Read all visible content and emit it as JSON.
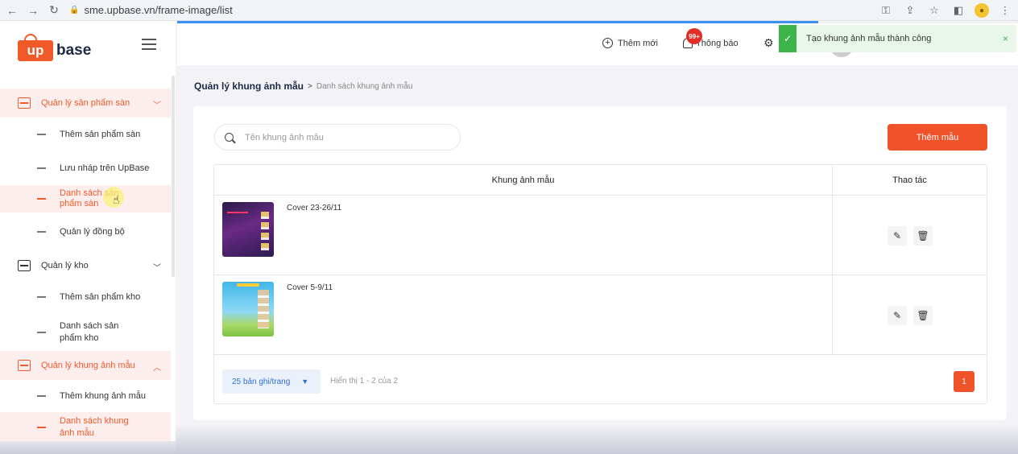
{
  "browser": {
    "url": "sme.upbase.vn/frame-image/list"
  },
  "logo": {
    "mark": "up",
    "text": "base"
  },
  "sidebar": {
    "groups": [
      {
        "label": "Quản lý sản phẩm sàn",
        "items": [
          "Thêm sản phẩm sàn",
          "Lưu nháp trên UpBase",
          "Danh sách sản phẩm sàn",
          "Quản lý đồng bộ"
        ]
      },
      {
        "label": "Quản lý kho",
        "items": [
          "Thêm sản phẩm kho",
          "Danh sách sản phẩm kho"
        ]
      },
      {
        "label": "Quản lý khung ảnh mẫu",
        "items": [
          "Thêm khung ảnh mẫu",
          "Danh sách khung ảnh mẫu"
        ]
      }
    ]
  },
  "topbar": {
    "add_label": "Thêm mới",
    "notification_label": "Thông báo",
    "notification_badge": "99+"
  },
  "toast": {
    "message": "Tạo khung ảnh mẫu thành công",
    "close": "×"
  },
  "breadcrumb": {
    "main": "Quản lý khung ảnh mẫu",
    "sep": ">",
    "sub": "Danh sách khung ảnh mẫu"
  },
  "search": {
    "placeholder": "Tên khung ảnh mẫu",
    "value": ""
  },
  "add_button": "Thêm mẫu",
  "table": {
    "headers": [
      "Khung ảnh mẫu",
      "Thao tác"
    ],
    "rows": [
      {
        "name": "Cover 23-26/11"
      },
      {
        "name": "Cover 5-9/11"
      }
    ]
  },
  "pagination": {
    "page_size": "25 bản ghi/trang",
    "info": "Hiển thị 1 - 2 của 2",
    "current_page": "1"
  },
  "colors": {
    "accent": "#f0522a",
    "success": "#3db44a",
    "link": "#3d8ff0"
  }
}
